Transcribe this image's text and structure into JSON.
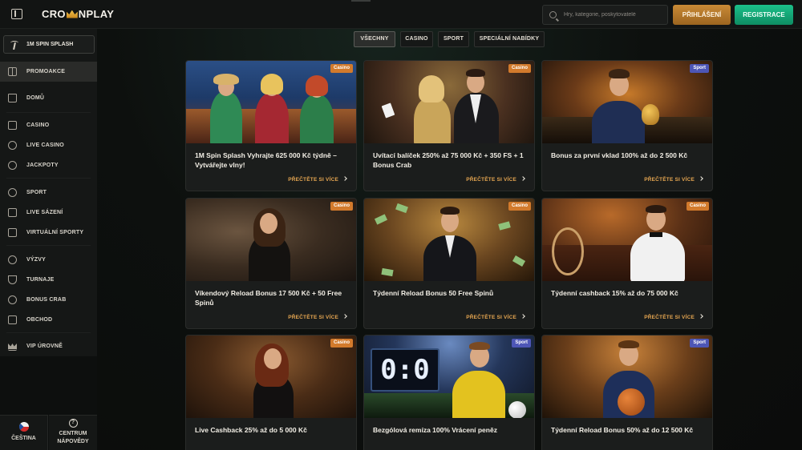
{
  "header": {
    "logo_text_before": "CRO",
    "logo_text_after": "NPLAY",
    "search_placeholder": "Hry, kategorie, poskytovatelé",
    "login_label": "PŘIHLÁŠENÍ",
    "register_label": "REGISTRACE"
  },
  "sidebar": {
    "spin_label": "1M SPIN SPLASH",
    "items": [
      {
        "label": "PROMOAKCE",
        "icon": "gift-icon"
      },
      {
        "label": "DOMŮ",
        "icon": "home-icon"
      },
      {
        "label": "CASINO",
        "icon": "casino-icon"
      },
      {
        "label": "LIVE CASINO",
        "icon": "spade-icon"
      },
      {
        "label": "JACKPOTY",
        "icon": "jackpot-icon"
      },
      {
        "label": "SPORT",
        "icon": "ball-icon"
      },
      {
        "label": "LIVE SÁZENÍ",
        "icon": "live-bet-icon"
      },
      {
        "label": "VIRTUÁLNÍ SPORTY",
        "icon": "gamepad-icon"
      },
      {
        "label": "VÝZVY",
        "icon": "medal-icon"
      },
      {
        "label": "TURNAJE",
        "icon": "trophy-icon"
      },
      {
        "label": "BONUS CRAB",
        "icon": "crab-icon"
      },
      {
        "label": "OBCHOD",
        "icon": "shop-icon"
      },
      {
        "label": "VIP ÚROVNĚ",
        "icon": "crown-icon"
      }
    ],
    "language_label": "ČEŠTINA",
    "help_label_1": "CENTRUM",
    "help_label_2": "NÁPOVĚDY"
  },
  "filters": [
    "VŠECHNY",
    "CASINO",
    "SPORT",
    "SPECIÁLNÍ NABÍDKY"
  ],
  "read_more": "PŘEČTĚTE SI VÍCE",
  "cards": [
    {
      "title": "1M Spin Splash Vyhrajte 625 000 Kč týdně – Vytvářejte vlny!",
      "badge": "Casino"
    },
    {
      "title": "Uvítací balíček 250% až 75 000 Kč + 350 FS + 1 Bonus Crab",
      "badge": "Casino"
    },
    {
      "title": "Bonus za první vklad 100% až do 2 500 Kč",
      "badge": "Sport"
    },
    {
      "title": "Víkendový Reload Bonus 17 500 Kč + 50 Free Spinů",
      "badge": "Casino"
    },
    {
      "title": "Týdenní Reload Bonus 50 Free Spinů",
      "badge": "Casino"
    },
    {
      "title": "Týdenní cashback 15% až do 75 000 Kč",
      "badge": "Casino"
    },
    {
      "title": "Live Cashback 25% až do 5 000 Kč",
      "badge": "Casino"
    },
    {
      "title": "Bezgólová remíza 100% Vrácení peněz",
      "badge": "Sport"
    },
    {
      "title": "Týdenní Reload Bonus 50% až do 12 500 Kč",
      "badge": "Sport"
    }
  ],
  "scoreboard_text": "0:0",
  "colors": {
    "accent_gold": "#e6a651",
    "login": "#b87a2b",
    "register": "#16a877",
    "casino_badge": "#d27a2c",
    "sport_badge": "#4d56b6"
  }
}
